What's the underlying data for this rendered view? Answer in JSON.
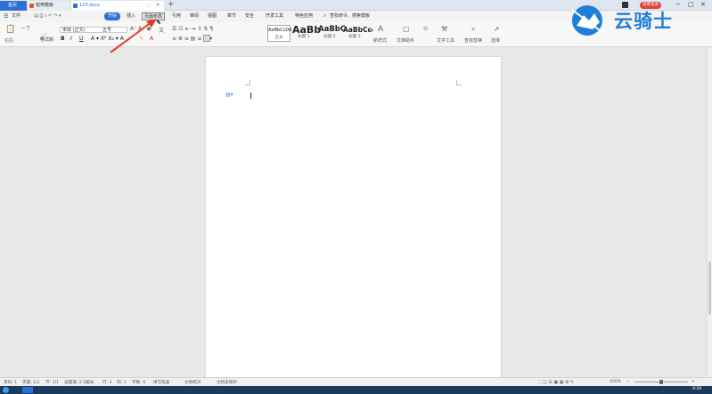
{
  "tabs": {
    "home": "首页",
    "template": "稻壳模板",
    "document": "123.docx",
    "new_tab": "+"
  },
  "menus": {
    "file": "文件",
    "items": [
      "开始",
      "插入",
      "页面布局",
      "引用",
      "审阅",
      "视图",
      "章节",
      "安全",
      "开发工具",
      "特色应用"
    ],
    "search_placeholder": "查找命令、搜索模板"
  },
  "toolbar": {
    "paste": "粘贴",
    "format_painter": "格式刷",
    "font_name": "宋体 (正文)",
    "font_size": "五号",
    "styles": [
      {
        "sample": "AaBbCcDd",
        "label": "正文"
      },
      {
        "sample": "AaBb",
        "label": "标题 1"
      },
      {
        "sample": "AaBbC",
        "label": "标题 2"
      },
      {
        "sample": "AaBbCc",
        "label": "标题 3"
      }
    ],
    "new_style": "新样式",
    "doc_assistant": "文档助手",
    "text_tools": "文字工具",
    "find_replace": "查找替换",
    "select": "选择"
  },
  "status": {
    "page_num": "页码: 1",
    "page": "页面: 1/1",
    "section": "节: 1/1",
    "position": "设置值: 2.5厘米",
    "row": "行: 1",
    "col": "列: 1",
    "words": "字数: 0",
    "spell": "拼写检查",
    "proof": "文档校对",
    "unprotected": "文档未保护",
    "zoom": "100%"
  },
  "taskbar": {
    "time": "9:28"
  },
  "logo": {
    "text": "云骑士"
  },
  "user": {
    "login_label": "访客登录"
  },
  "colors": {
    "accent": "#2d6fd6",
    "logo": "#1f7fd8",
    "annotation_arrow": "#e03a2e"
  }
}
